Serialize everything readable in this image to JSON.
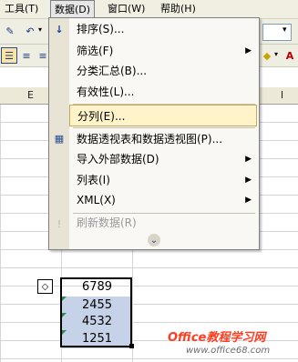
{
  "menubar": {
    "items": [
      {
        "label": "工具(T)"
      },
      {
        "label": "数据(D)"
      },
      {
        "label": "窗口(W)"
      },
      {
        "label": "帮助(H)"
      }
    ]
  },
  "grid": {
    "column_e": "E",
    "column_right": "I",
    "values": [
      "6789",
      "2455",
      "4532",
      "1251"
    ]
  },
  "data_menu": {
    "items": [
      {
        "label": "排序(S)...",
        "has_submenu": false,
        "disabled": false
      },
      {
        "label": "筛选(F)",
        "has_submenu": true,
        "disabled": false
      },
      {
        "label": "分类汇总(B)...",
        "has_submenu": false,
        "disabled": false
      },
      {
        "label": "有效性(L)...",
        "has_submenu": false,
        "disabled": false
      },
      {
        "label": "分列(E)...",
        "has_submenu": false,
        "disabled": false,
        "highlighted": true
      },
      {
        "label": "数据透视表和数据透视图(P)...",
        "has_submenu": false,
        "disabled": false
      },
      {
        "label": "导入外部数据(D)",
        "has_submenu": true,
        "disabled": false
      },
      {
        "label": "列表(I)",
        "has_submenu": true,
        "disabled": false
      },
      {
        "label": "XML(X)",
        "has_submenu": true,
        "disabled": false
      },
      {
        "label": "刷新数据(R)",
        "has_submenu": false,
        "disabled": true
      }
    ],
    "expand_icon": "double-chevron-down-icon"
  },
  "watermark": {
    "title": "Office教程学习网",
    "url": "www.office68.com"
  },
  "colors": {
    "menu_highlight": "#fff4c9",
    "selection_fill": "#c6d2e7",
    "watermark_red": "#ff3d1f"
  }
}
